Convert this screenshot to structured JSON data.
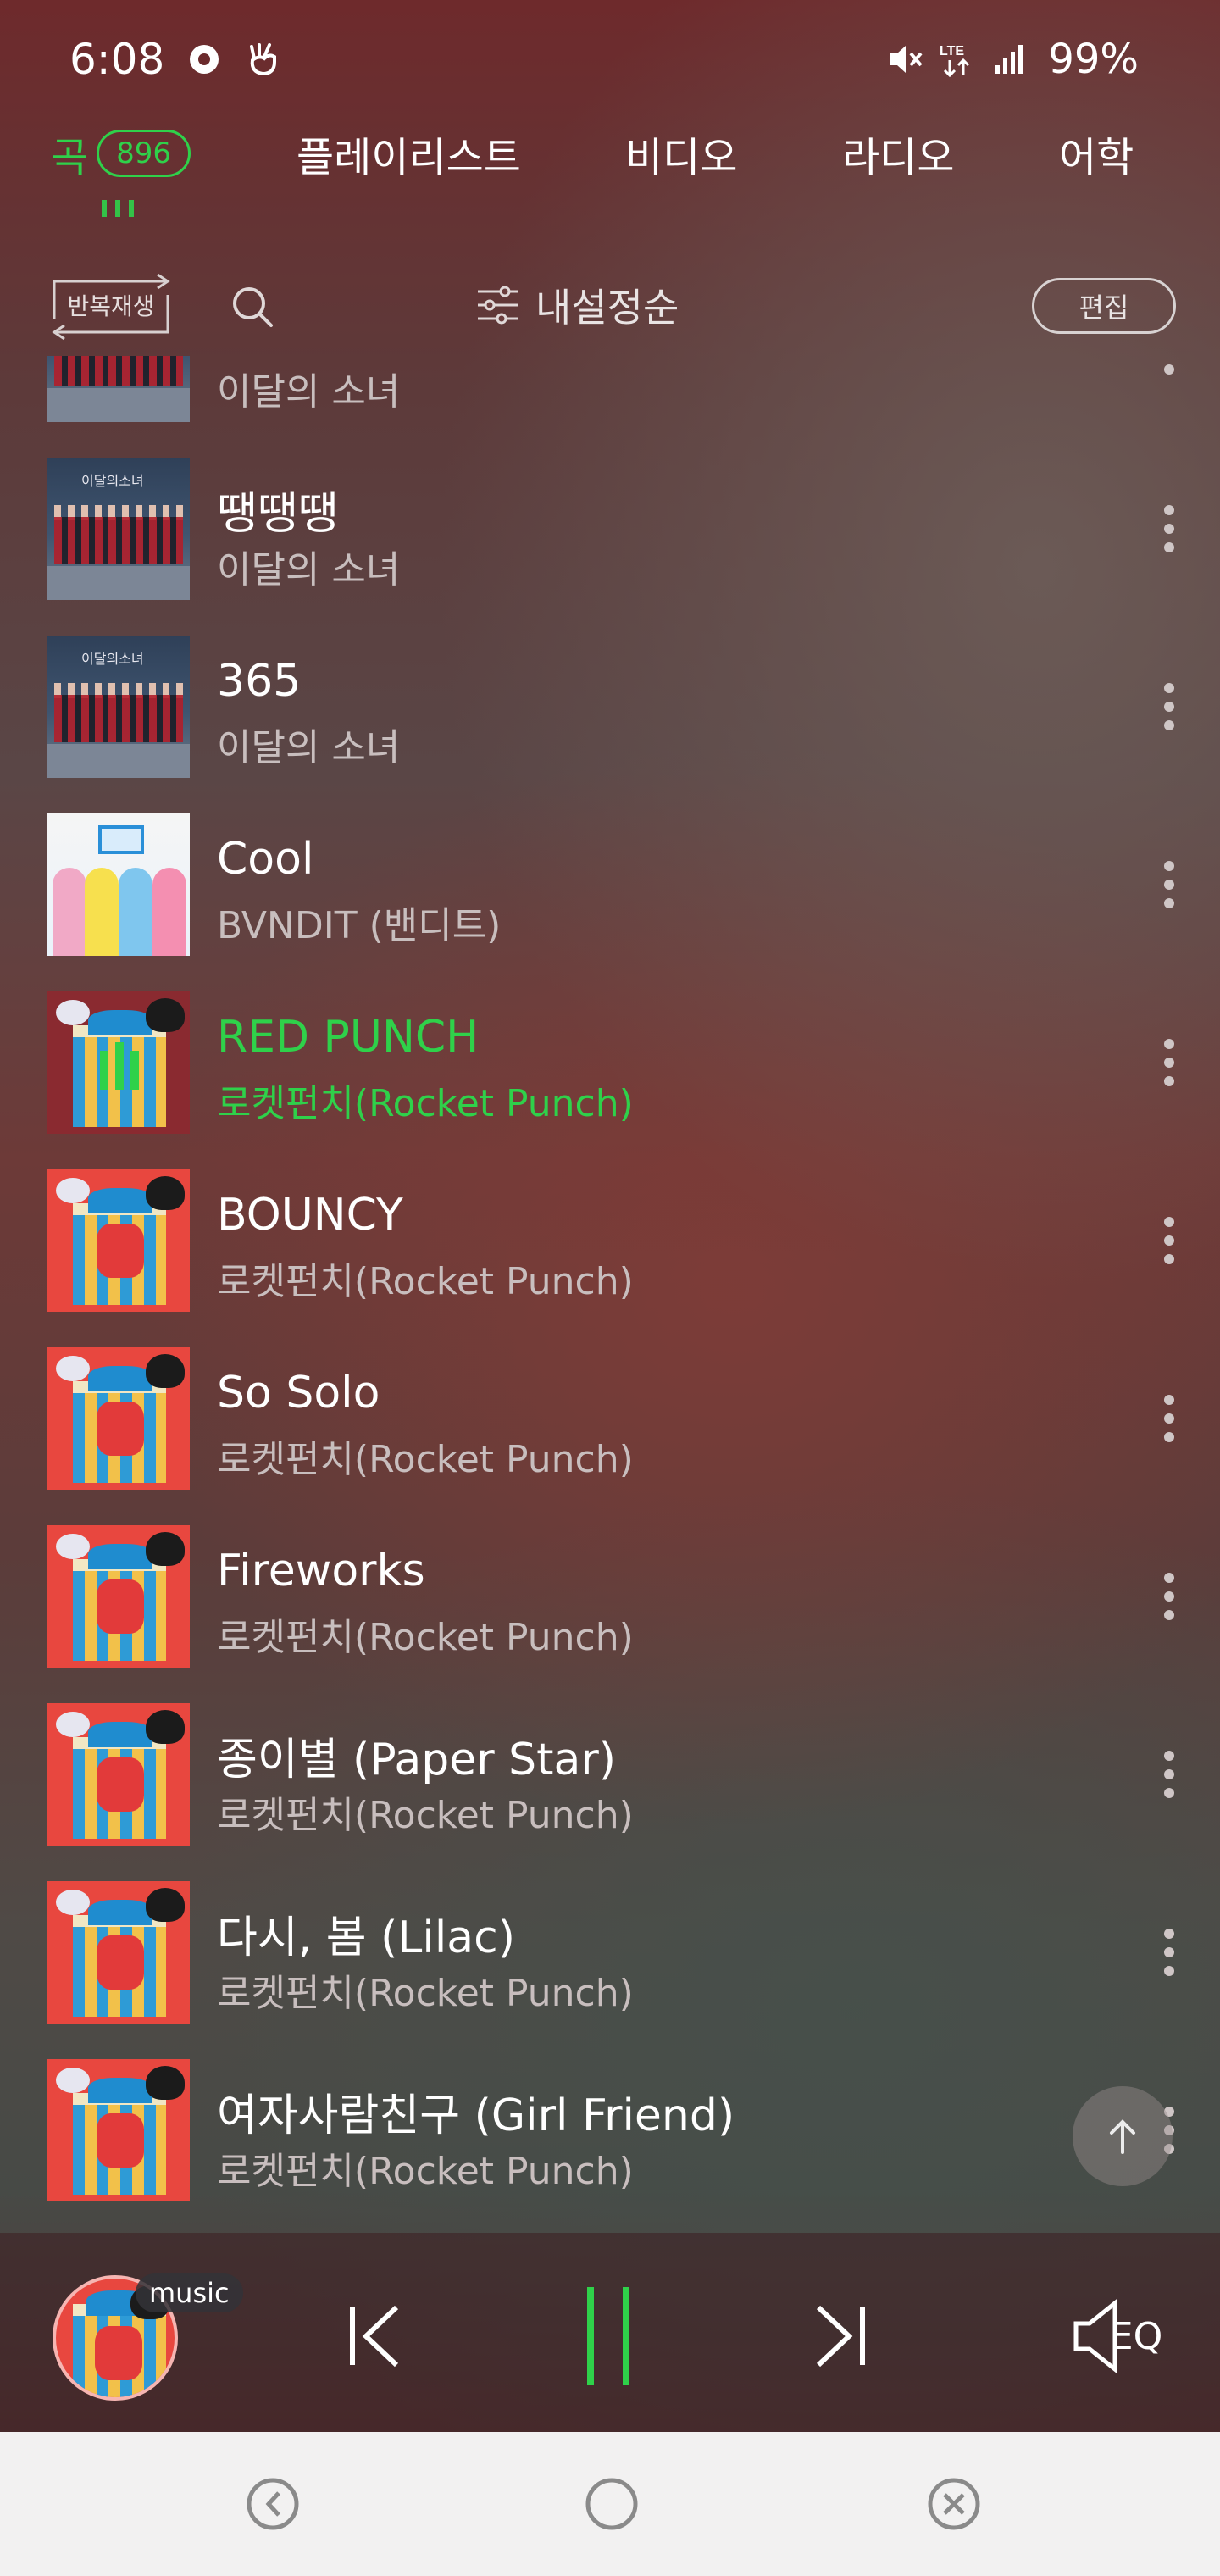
{
  "status_bar": {
    "time": "6:08",
    "battery": "99%",
    "network": "LTE",
    "icons": [
      "record-icon",
      "hand-gesture-icon",
      "mute-icon",
      "lte-icon",
      "signal-icon"
    ]
  },
  "tabs": [
    {
      "label": "곡",
      "count": "896",
      "active": true
    },
    {
      "label": "플레이리스트",
      "active": false
    },
    {
      "label": "비디오",
      "active": false
    },
    {
      "label": "라디오",
      "active": false
    },
    {
      "label": "어학",
      "active": false
    }
  ],
  "toolbar": {
    "repeat_label": "반복재생",
    "sort_label": "내설정순",
    "edit_label": "편집"
  },
  "songs": [
    {
      "title": "",
      "artist": "이달의 소녀",
      "art": "loona",
      "active": false
    },
    {
      "title": "땡땡땡",
      "artist": "이달의 소녀",
      "art": "loona",
      "active": false
    },
    {
      "title": "365",
      "artist": "이달의 소녀",
      "art": "loona",
      "active": false
    },
    {
      "title": "Cool",
      "artist": "BVNDIT (밴디트)",
      "art": "cool",
      "active": false
    },
    {
      "title": "RED PUNCH",
      "artist": "로켓펀치(Rocket Punch)",
      "art": "rocketpunch",
      "active": true
    },
    {
      "title": "BOUNCY",
      "artist": "로켓펀치(Rocket Punch)",
      "art": "rocketpunch",
      "active": false
    },
    {
      "title": "So Solo",
      "artist": "로켓펀치(Rocket Punch)",
      "art": "rocketpunch",
      "active": false
    },
    {
      "title": "Fireworks",
      "artist": "로켓펀치(Rocket Punch)",
      "art": "rocketpunch",
      "active": false
    },
    {
      "title": "종이별 (Paper Star)",
      "artist": "로켓펀치(Rocket Punch)",
      "art": "rocketpunch",
      "active": false
    },
    {
      "title": "다시, 봄 (Lilac)",
      "artist": "로켓펀치(Rocket Punch)",
      "art": "rocketpunch",
      "active": false
    },
    {
      "title": "여자사람친구 (Girl Friend)",
      "artist": "로켓펀치(Rocket Punch)",
      "art": "rocketpunch",
      "active": false
    }
  ],
  "player": {
    "badge": "music",
    "eq_label": "EQ",
    "accent": "#2fd14a"
  },
  "colors": {
    "accent": "#2fd14a",
    "navbar_bg": "#f2f1f1"
  }
}
